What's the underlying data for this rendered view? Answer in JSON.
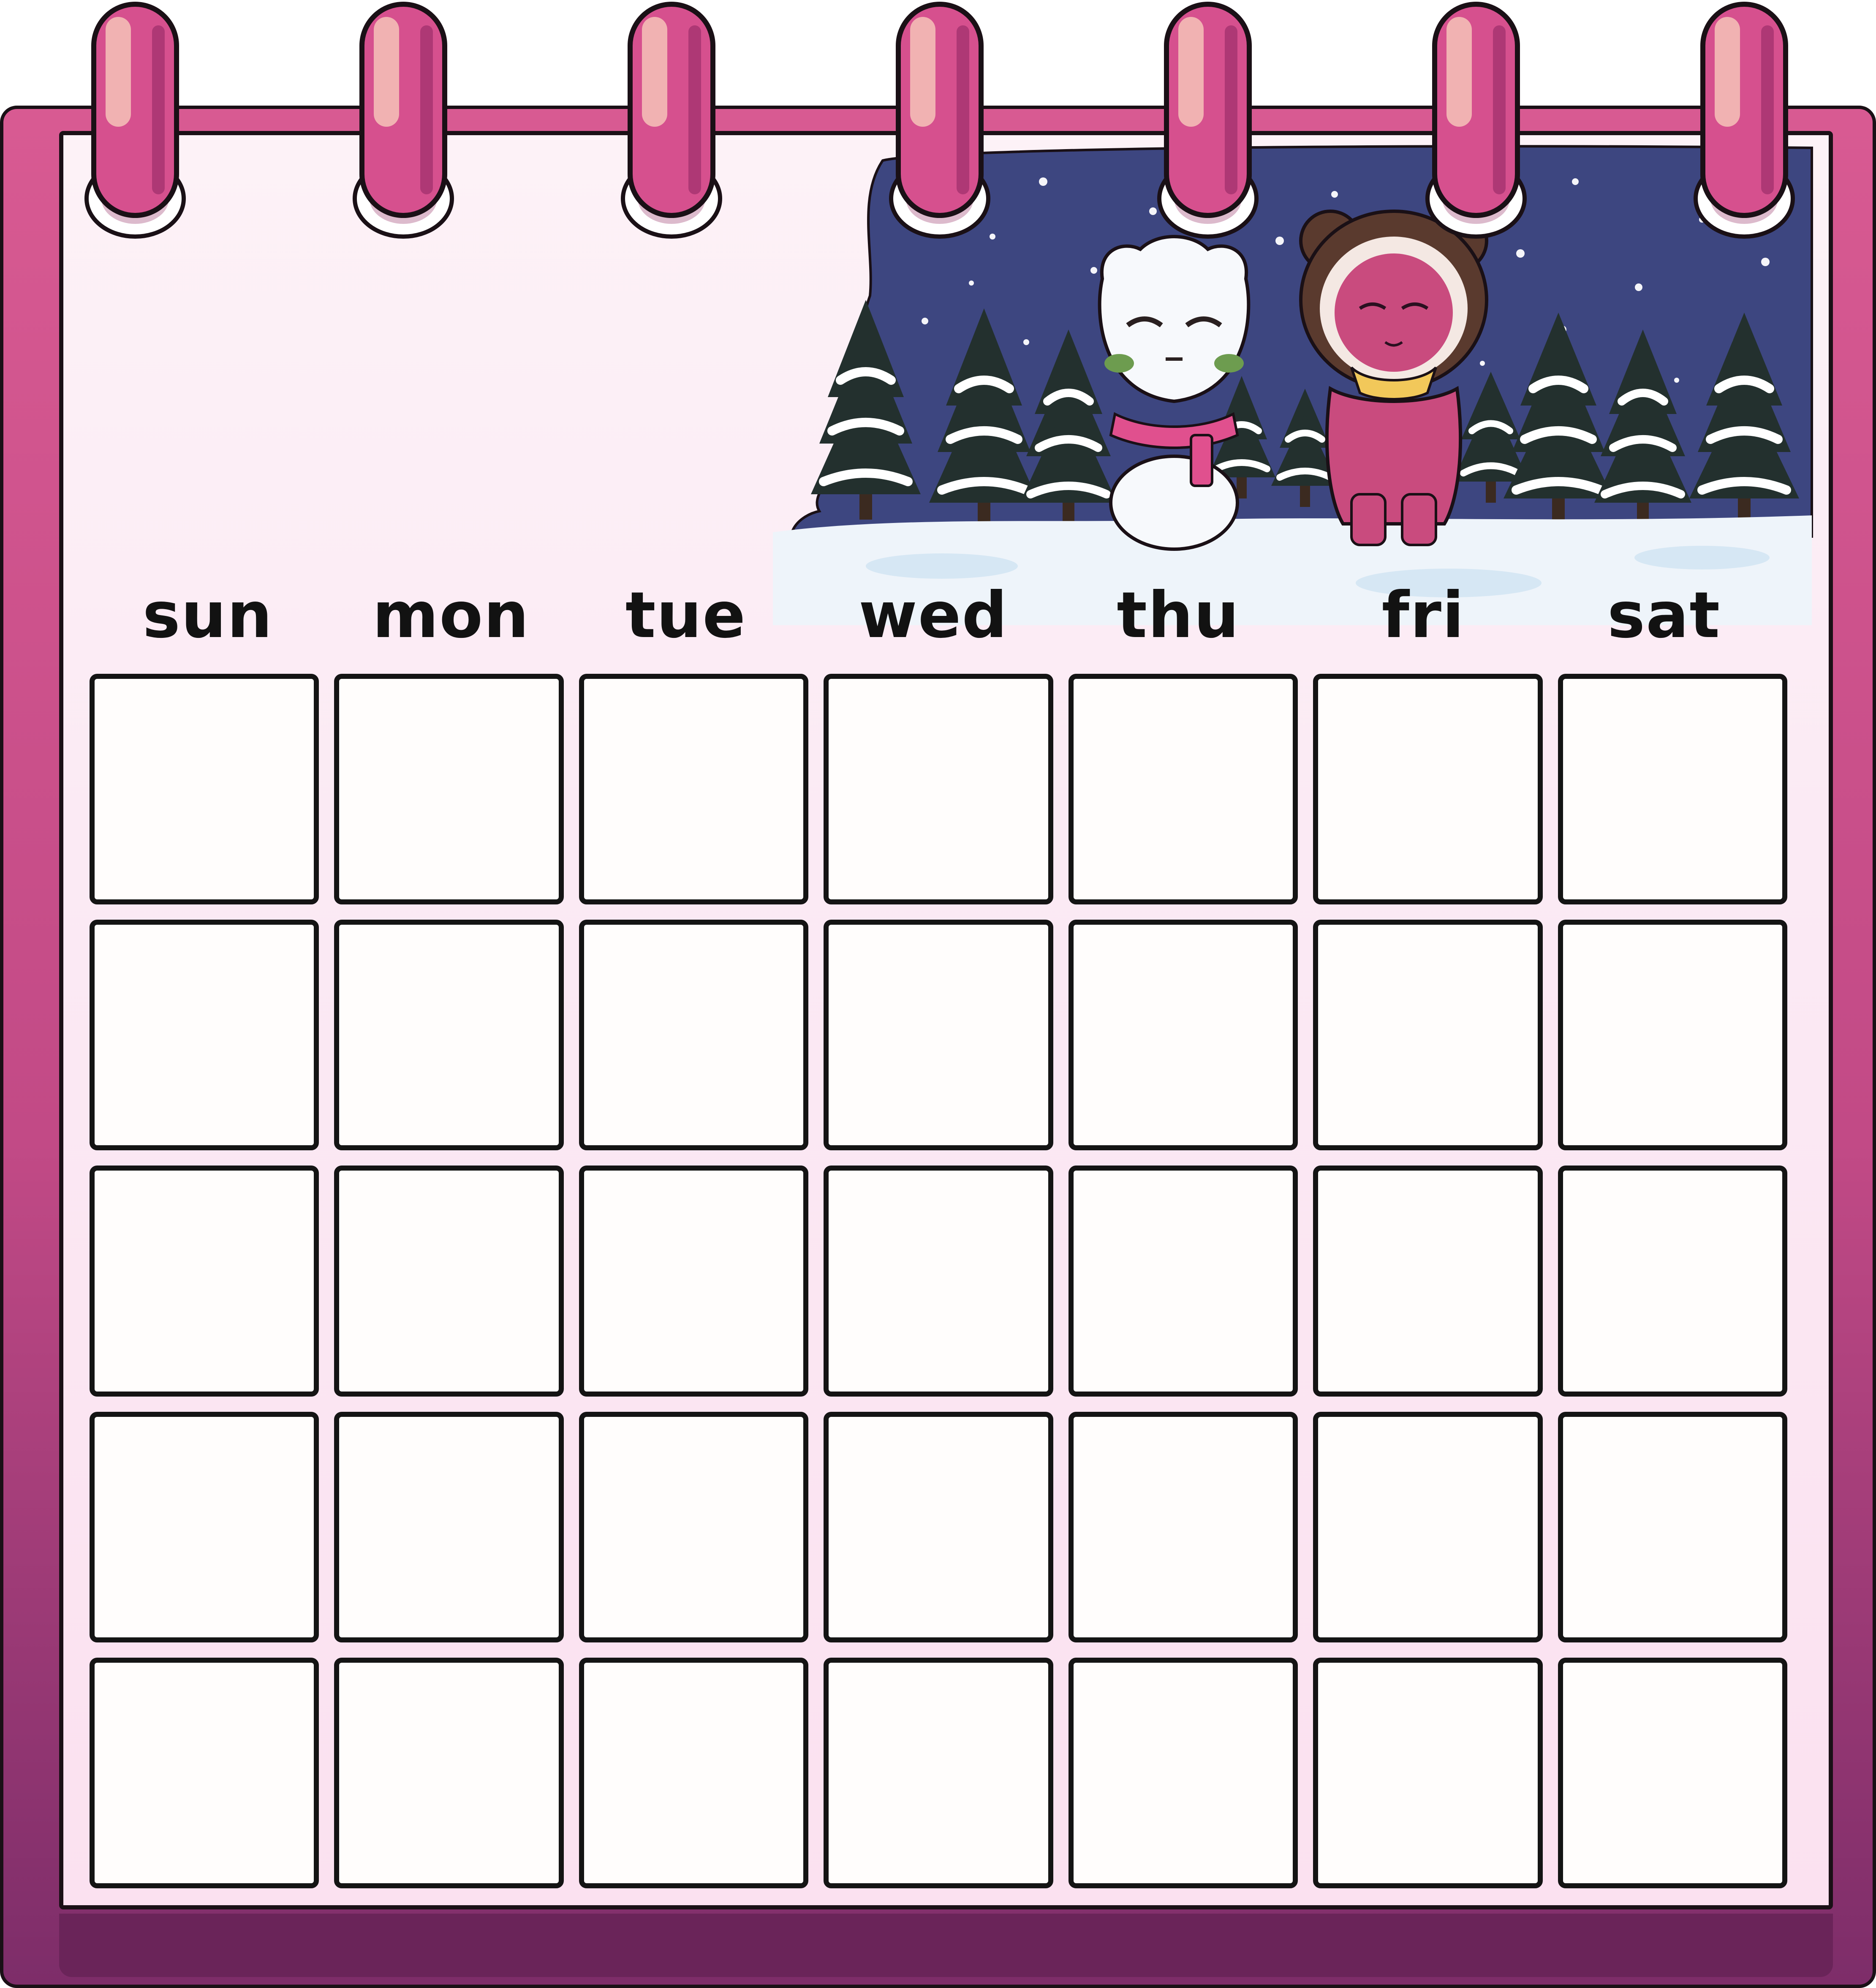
{
  "colors": {
    "backing": "#c24a86",
    "ring": "#d6508e",
    "paper": "#fdf2f7",
    "night_sky": "#3d4680",
    "cell_fill": "#fffdfc",
    "outline": "#141414"
  },
  "illustration": {
    "scene": "snowy-night",
    "characters": [
      "snowman-icon",
      "bear-hood-character-icon"
    ]
  },
  "weekdays": [
    "sun",
    "mon",
    "tue",
    "wed",
    "thu",
    "fri",
    "sat"
  ],
  "grid": {
    "rows": 5,
    "columns": 7
  }
}
